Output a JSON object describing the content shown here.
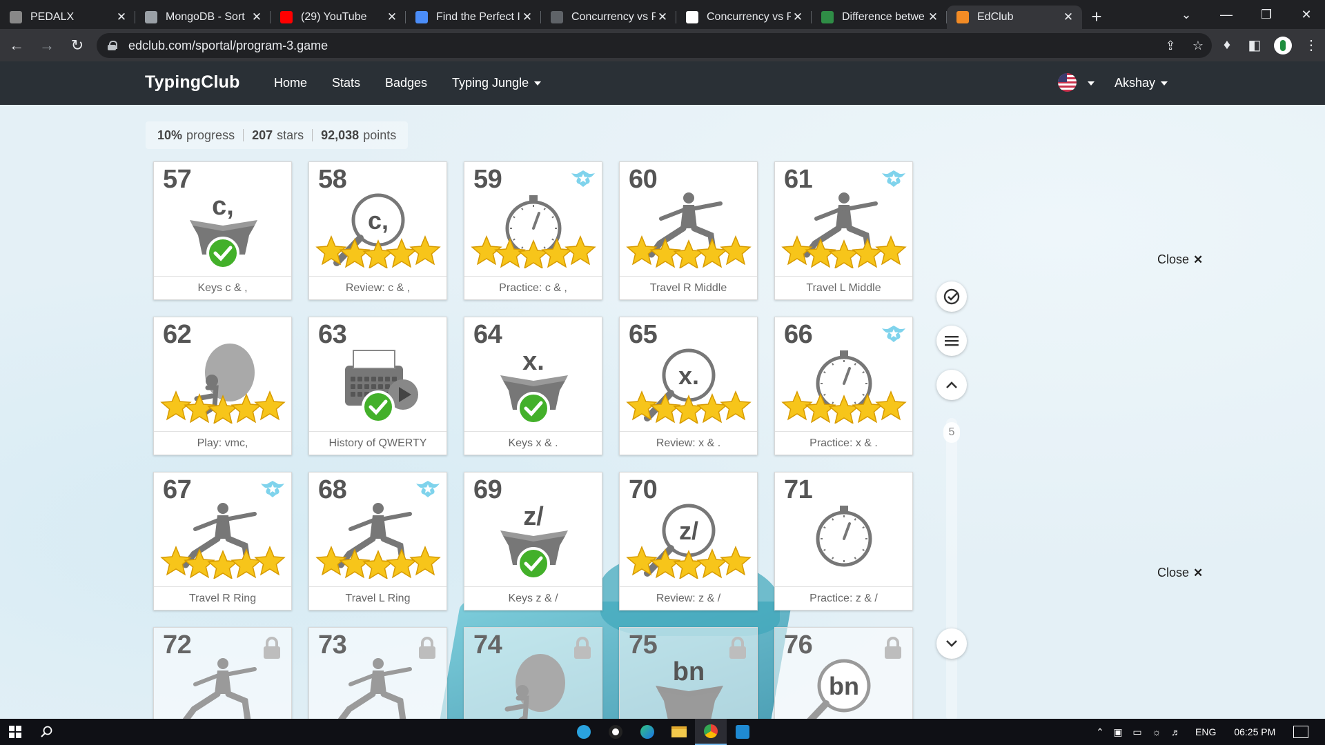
{
  "browser": {
    "tabs": [
      {
        "title": "PEDALX",
        "favicon": "pedalx-icon",
        "favcolor": "#888888",
        "active": false
      },
      {
        "title": "MongoDB - Sort",
        "favicon": "mongodb-icon",
        "favcolor": "#9aa0a6",
        "active": false
      },
      {
        "title": "(29) YouTube",
        "favicon": "youtube-icon",
        "favcolor": "#ff0000",
        "active": false
      },
      {
        "title": "Find the Perfect I",
        "favicon": "flag-icon",
        "favcolor": "#4b8df8",
        "active": false
      },
      {
        "title": "Concurrency vs P",
        "favicon": "page-icon",
        "favcolor": "#5f6368",
        "active": false
      },
      {
        "title": "Concurrency vs P",
        "favicon": "google-icon",
        "favcolor": "#ffffff",
        "active": false
      },
      {
        "title": "Difference betwe",
        "favicon": "gfg-icon",
        "favcolor": "#2f8d46",
        "active": false
      },
      {
        "title": "EdClub",
        "favicon": "edclub-icon",
        "favcolor": "#f28b25",
        "active": true
      }
    ],
    "url": "edclub.com/sportal/program-3.game"
  },
  "site": {
    "brand": "TypingClub",
    "nav": [
      "Home",
      "Stats",
      "Badges",
      "Typing Jungle"
    ],
    "user": "Akshay"
  },
  "summary": {
    "progress_value": "10%",
    "progress_label": "progress",
    "stars_value": "207",
    "stars_label": "stars",
    "points_value": "92,038",
    "points_label": "points"
  },
  "lessons": [
    {
      "num": "57",
      "label": "Keys c & ,",
      "type": "keys",
      "glyph": "c,",
      "stars": 0,
      "done": true,
      "badge": false,
      "locked": false
    },
    {
      "num": "58",
      "label": "Review: c & ,",
      "type": "review",
      "glyph": "c,",
      "stars": 5,
      "done": false,
      "badge": false,
      "locked": false
    },
    {
      "num": "59",
      "label": "Practice: c & ,",
      "type": "practice",
      "glyph": "",
      "stars": 5,
      "done": false,
      "badge": true,
      "locked": false
    },
    {
      "num": "60",
      "label": "Travel R Middle",
      "type": "travel",
      "glyph": "",
      "stars": 5,
      "done": false,
      "badge": false,
      "locked": false
    },
    {
      "num": "61",
      "label": "Travel L Middle",
      "type": "travel",
      "glyph": "",
      "stars": 5,
      "done": false,
      "badge": true,
      "locked": false
    },
    {
      "num": "62",
      "label": "Play: vmc,",
      "type": "play",
      "glyph": "",
      "stars": 5,
      "done": false,
      "badge": false,
      "locked": false
    },
    {
      "num": "63",
      "label": "History of QWERTY",
      "type": "history",
      "glyph": "",
      "stars": 0,
      "done": true,
      "badge": false,
      "locked": false
    },
    {
      "num": "64",
      "label": "Keys x & .",
      "type": "keys",
      "glyph": "x.",
      "stars": 0,
      "done": true,
      "badge": false,
      "locked": false
    },
    {
      "num": "65",
      "label": "Review: x & .",
      "type": "review",
      "glyph": "x.",
      "stars": 5,
      "done": false,
      "badge": false,
      "locked": false
    },
    {
      "num": "66",
      "label": "Practice: x & .",
      "type": "practice",
      "glyph": "",
      "stars": 5,
      "done": false,
      "badge": true,
      "locked": false
    },
    {
      "num": "67",
      "label": "Travel R Ring",
      "type": "travel",
      "glyph": "",
      "stars": 5,
      "done": false,
      "badge": true,
      "locked": false
    },
    {
      "num": "68",
      "label": "Travel L Ring",
      "type": "travel",
      "glyph": "",
      "stars": 5,
      "done": false,
      "badge": true,
      "locked": false
    },
    {
      "num": "69",
      "label": "Keys z & /",
      "type": "keys",
      "glyph": "z/",
      "stars": 0,
      "done": true,
      "badge": false,
      "locked": false
    },
    {
      "num": "70",
      "label": "Review: z & /",
      "type": "review",
      "glyph": "z/",
      "stars": 5,
      "done": false,
      "badge": false,
      "locked": false
    },
    {
      "num": "71",
      "label": "Practice: z & /",
      "type": "practice",
      "glyph": "",
      "stars": 0,
      "done": false,
      "badge": false,
      "locked": false
    },
    {
      "num": "72",
      "label": "",
      "type": "travel",
      "glyph": "",
      "stars": 0,
      "done": false,
      "badge": false,
      "locked": true
    },
    {
      "num": "73",
      "label": "",
      "type": "travel",
      "glyph": "",
      "stars": 0,
      "done": false,
      "badge": false,
      "locked": true
    },
    {
      "num": "74",
      "label": "",
      "type": "play",
      "glyph": "",
      "stars": 0,
      "done": false,
      "badge": false,
      "locked": true
    },
    {
      "num": "75",
      "label": "",
      "type": "keys",
      "glyph": "bn",
      "stars": 0,
      "done": false,
      "badge": false,
      "locked": true
    },
    {
      "num": "76",
      "label": "",
      "type": "review",
      "glyph": "bn",
      "stars": 0,
      "done": false,
      "badge": false,
      "locked": true
    }
  ],
  "side": {
    "page_indicator": "5",
    "close_label": "Close"
  },
  "taskbar": {
    "lang": "ENG",
    "time": "06:25 PM"
  },
  "colors": {
    "star": "#f7c51a",
    "check": "#43b02a",
    "badge": "#7fd3ec",
    "nav": "#2a3036"
  }
}
